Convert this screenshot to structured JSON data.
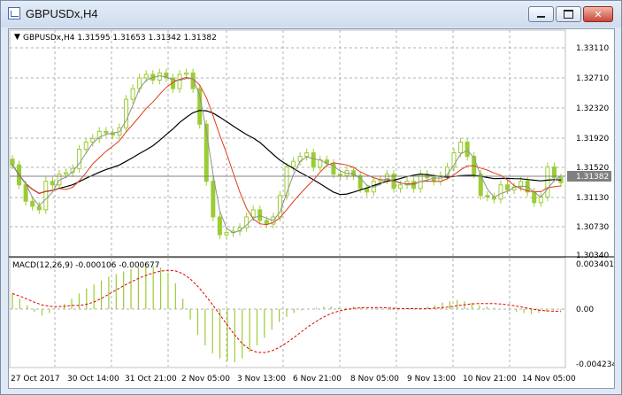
{
  "window": {
    "title": "GBPUSDx,H4",
    "buttons": {
      "minimize": "minimize",
      "maximize": "maximize",
      "close": "✕"
    }
  },
  "chart": {
    "header": "GBPUSDx,H4  1.31595 1.31653 1.31342 1.31382",
    "price_axis": [
      "1.33110",
      "1.32710",
      "1.32320",
      "1.31920",
      "1.31520",
      "1.31130",
      "1.30730",
      "1.30340"
    ],
    "current_price": "1.31382",
    "macd_label": "MACD(12,26,9) -0.000106 -0.000677",
    "macd_axis": [
      "0.003401",
      "0.00",
      "-0.004234"
    ],
    "time_axis": [
      "27 Oct 2017",
      "30 Oct 14:00",
      "31 Oct 21:00",
      "2 Nov 05:00",
      "3 Nov 13:00",
      "6 Nov 21:00",
      "8 Nov 05:00",
      "9 Nov 13:00",
      "10 Nov 21:00",
      "14 Nov 05:00"
    ],
    "colors": {
      "candle": "#9acd32",
      "grid": "#b0b0b0",
      "ma_fast": "#808080",
      "ma_mid": "#e03c1c",
      "ma_slow": "#000000",
      "signal": "#e00000"
    }
  },
  "chart_data": {
    "type": "line",
    "title": "GBPUSDx,H4",
    "ylim": [
      1.3034,
      1.3335
    ],
    "close": [
      1.3163,
      1.3135,
      1.3112,
      1.3105,
      1.31,
      1.314,
      1.3135,
      1.315,
      1.3152,
      1.3158,
      1.3185,
      1.3195,
      1.32,
      1.321,
      1.3208,
      1.3205,
      1.3215,
      1.3255,
      1.327,
      1.3285,
      1.329,
      1.3282,
      1.3292,
      1.3285,
      1.327,
      1.329,
      1.3292,
      1.327,
      1.322,
      1.314,
      1.309,
      1.3065,
      1.3068,
      1.307,
      1.3075,
      1.309,
      1.31,
      1.3085,
      1.308,
      1.309,
      1.312,
      1.316,
      1.3168,
      1.3175,
      1.318,
      1.316,
      1.317,
      1.3165,
      1.315,
      1.3148,
      1.3155,
      1.3148,
      1.313,
      1.3125,
      1.314,
      1.3142,
      1.315,
      1.313,
      1.3135,
      1.314,
      1.313,
      1.315,
      1.3145,
      1.314,
      1.3148,
      1.316,
      1.318,
      1.3195,
      1.3175,
      1.315,
      1.312,
      1.3118,
      1.3115,
      1.3135,
      1.3128,
      1.3132,
      1.314,
      1.3125,
      1.311,
      1.3118,
      1.316,
      1.3145,
      1.3138
    ],
    "macd_hist": [
      0.0012,
      0.0008,
      0.0003,
      -0.0002,
      -0.0005,
      -0.0003,
      0.0,
      0.0004,
      0.0008,
      0.0012,
      0.0016,
      0.0019,
      0.0022,
      0.0025,
      0.0027,
      0.0029,
      0.0031,
      0.0032,
      0.0033,
      0.0033,
      0.0032,
      0.0028,
      0.002,
      0.0008,
      -0.0008,
      -0.002,
      -0.0028,
      -0.0034,
      -0.0038,
      -0.004,
      -0.0041,
      -0.0038,
      -0.0033,
      -0.0028,
      -0.0022,
      -0.0016,
      -0.001,
      -0.0006,
      -0.0003,
      -0.0001,
      0.0,
      0.0001,
      0.0002,
      0.0002,
      0.0001,
      0.0001,
      0.0002,
      0.0001,
      0.0,
      0.0001,
      0.0,
      -0.0001,
      -0.0001,
      0.0,
      0.0001,
      0.0001,
      0.0002,
      0.0003,
      0.0005,
      0.0006,
      0.0007,
      0.0006,
      0.0005,
      0.0003,
      0.0002,
      0.0001,
      0.0,
      -0.0001,
      -0.0002,
      -0.0003,
      -0.0004,
      -0.0003,
      -0.0002,
      -0.0001,
      -0.0001
    ]
  }
}
